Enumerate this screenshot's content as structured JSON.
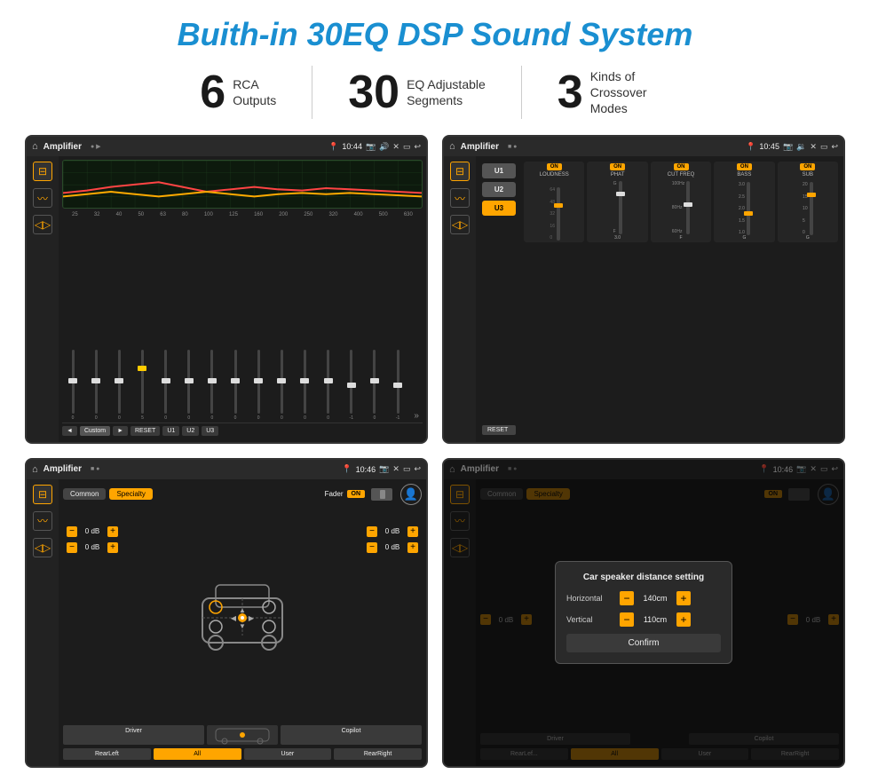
{
  "title": "Buith-in 30EQ DSP Sound System",
  "stats": [
    {
      "number": "6",
      "label": "RCA\nOutputs"
    },
    {
      "number": "30",
      "label": "EQ Adjustable\nSegments"
    },
    {
      "number": "3",
      "label": "Kinds of\nCrossover Modes"
    }
  ],
  "screens": [
    {
      "id": "eq-screen",
      "topbar": {
        "title": "Amplifier",
        "time": "10:44"
      },
      "type": "eq",
      "freqs": [
        "25",
        "32",
        "40",
        "50",
        "63",
        "80",
        "100",
        "125",
        "160",
        "200",
        "250",
        "320",
        "400",
        "500",
        "630"
      ],
      "sliderValues": [
        "0",
        "0",
        "0",
        "5",
        "0",
        "0",
        "0",
        "0",
        "0",
        "0",
        "0",
        "0",
        "-1",
        "0",
        "-1"
      ],
      "bottomBtns": [
        "◄",
        "Custom",
        "►",
        "RESET",
        "U1",
        "U2",
        "U3"
      ]
    },
    {
      "id": "amp-screen",
      "topbar": {
        "title": "Amplifier",
        "time": "10:45"
      },
      "type": "amp",
      "presets": [
        "U1",
        "U2",
        "U3"
      ],
      "activePreset": 0,
      "channels": [
        {
          "label": "LOUDNESS",
          "on": true,
          "value": "ON"
        },
        {
          "label": "PHAT",
          "on": true,
          "value": "ON"
        },
        {
          "label": "CUT FREQ",
          "on": true,
          "value": "ON"
        },
        {
          "label": "BASS",
          "on": true,
          "value": "ON"
        },
        {
          "label": "SUB",
          "on": true,
          "value": "ON"
        }
      ]
    },
    {
      "id": "crossover-screen",
      "topbar": {
        "title": "Amplifier",
        "time": "10:46"
      },
      "type": "crossover",
      "tabs": [
        "Common",
        "Specialty"
      ],
      "activeTab": 1,
      "faderLabel": "Fader",
      "faderOn": true,
      "dbValues": [
        "0 dB",
        "0 dB",
        "0 dB",
        "0 dB"
      ],
      "bottomBtns": [
        "Driver",
        "",
        "Copilot",
        "RearLeft",
        "All",
        "User",
        "RearRight"
      ]
    },
    {
      "id": "dialog-screen",
      "topbar": {
        "title": "Amplifier",
        "time": "10:46"
      },
      "type": "dialog",
      "tabs": [
        "Common",
        "Specialty"
      ],
      "activeTab": 1,
      "faderOn": true,
      "dialog": {
        "title": "Car speaker distance setting",
        "horizontal": {
          "label": "Horizontal",
          "value": "140cm"
        },
        "vertical": {
          "label": "Vertical",
          "value": "110cm"
        },
        "confirmLabel": "Confirm"
      },
      "dbValues": [
        "0 dB",
        "0 dB"
      ],
      "bottomBtns": [
        "Driver",
        "Copilot",
        "RearLeft",
        "User",
        "RearRight"
      ]
    }
  ]
}
